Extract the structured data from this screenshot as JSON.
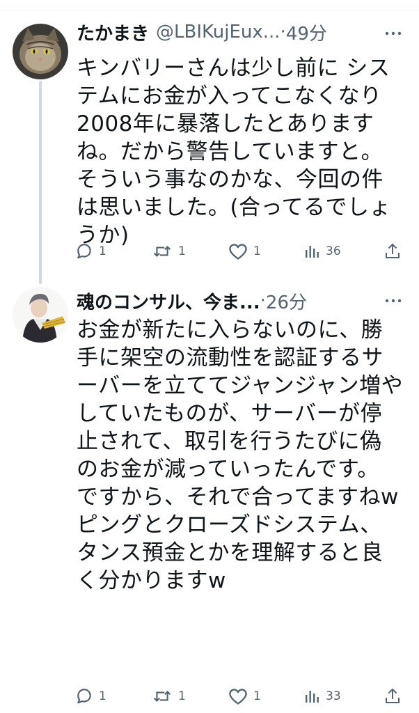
{
  "thread": [
    {
      "user": {
        "name": "たかまき",
        "handle": "@LBIKujEux..."
      },
      "separator": "·",
      "time": "49分",
      "text": "キンバリーさんは少し前に システムにお金が入ってこなくなり 2008年に暴落したとありますね。だから警告していますと。そういう事なのかな、今回の件は思いました。(合ってるでしょうか)",
      "actions": {
        "reply": "1",
        "retweet": "1",
        "like": "1",
        "views": "36"
      }
    },
    {
      "user": {
        "name": "魂のコンサル、今ま...",
        "handle": ""
      },
      "separator": "·",
      "time": "26分",
      "text": "お金が新たに入らないのに、勝手に架空の流動性を認証するサーバーを立ててジャンジャン増やしていたものが、サーバーが停止されて、取引を行うたびに偽のお金が減っていったんです。\nですから、それで合ってますねw\nピングとクローズドシステム、タンス預金とかを理解すると良く分かりますw",
      "actions": {
        "reply": "1",
        "retweet": "1",
        "like": "1",
        "views": "33"
      }
    }
  ],
  "icons": {
    "more": "more-horizontal-icon",
    "reply": "reply-icon",
    "retweet": "retweet-icon",
    "like": "heart-icon",
    "views": "views-chart-icon",
    "share": "share-icon"
  },
  "colors": {
    "text": "#0f1419",
    "secondary": "#536471",
    "thread_line": "#cfd9de",
    "divider": "#eff3f4"
  }
}
